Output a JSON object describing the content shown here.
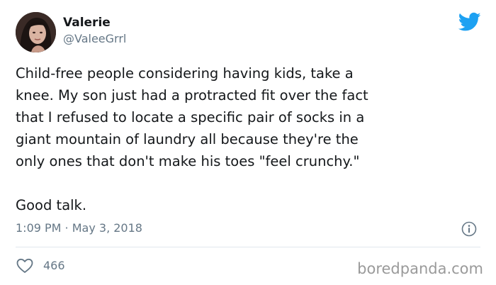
{
  "author": {
    "name": "Valerie",
    "handle": "@ValeeGrrl"
  },
  "tweet": {
    "lines": [
      "Child-free people considering having kids, take a",
      "knee. My son just had a protracted fit over the fact",
      "that I refused to locate a specific pair of socks in a",
      "giant mountain of laundry all because they're the",
      "only ones that don't make his toes \"feel crunchy.\""
    ],
    "closing": "Good talk.",
    "timestamp": "1:09 PM · May 3, 2018",
    "likes": "466"
  },
  "watermark": "boredpanda.com",
  "colors": {
    "twitter_blue": "#1da1f2",
    "muted_text": "#657786",
    "divider": "#e1e8ed"
  },
  "icons": {
    "brand": "twitter-bird-icon",
    "info": "info-icon",
    "like": "heart-icon"
  }
}
